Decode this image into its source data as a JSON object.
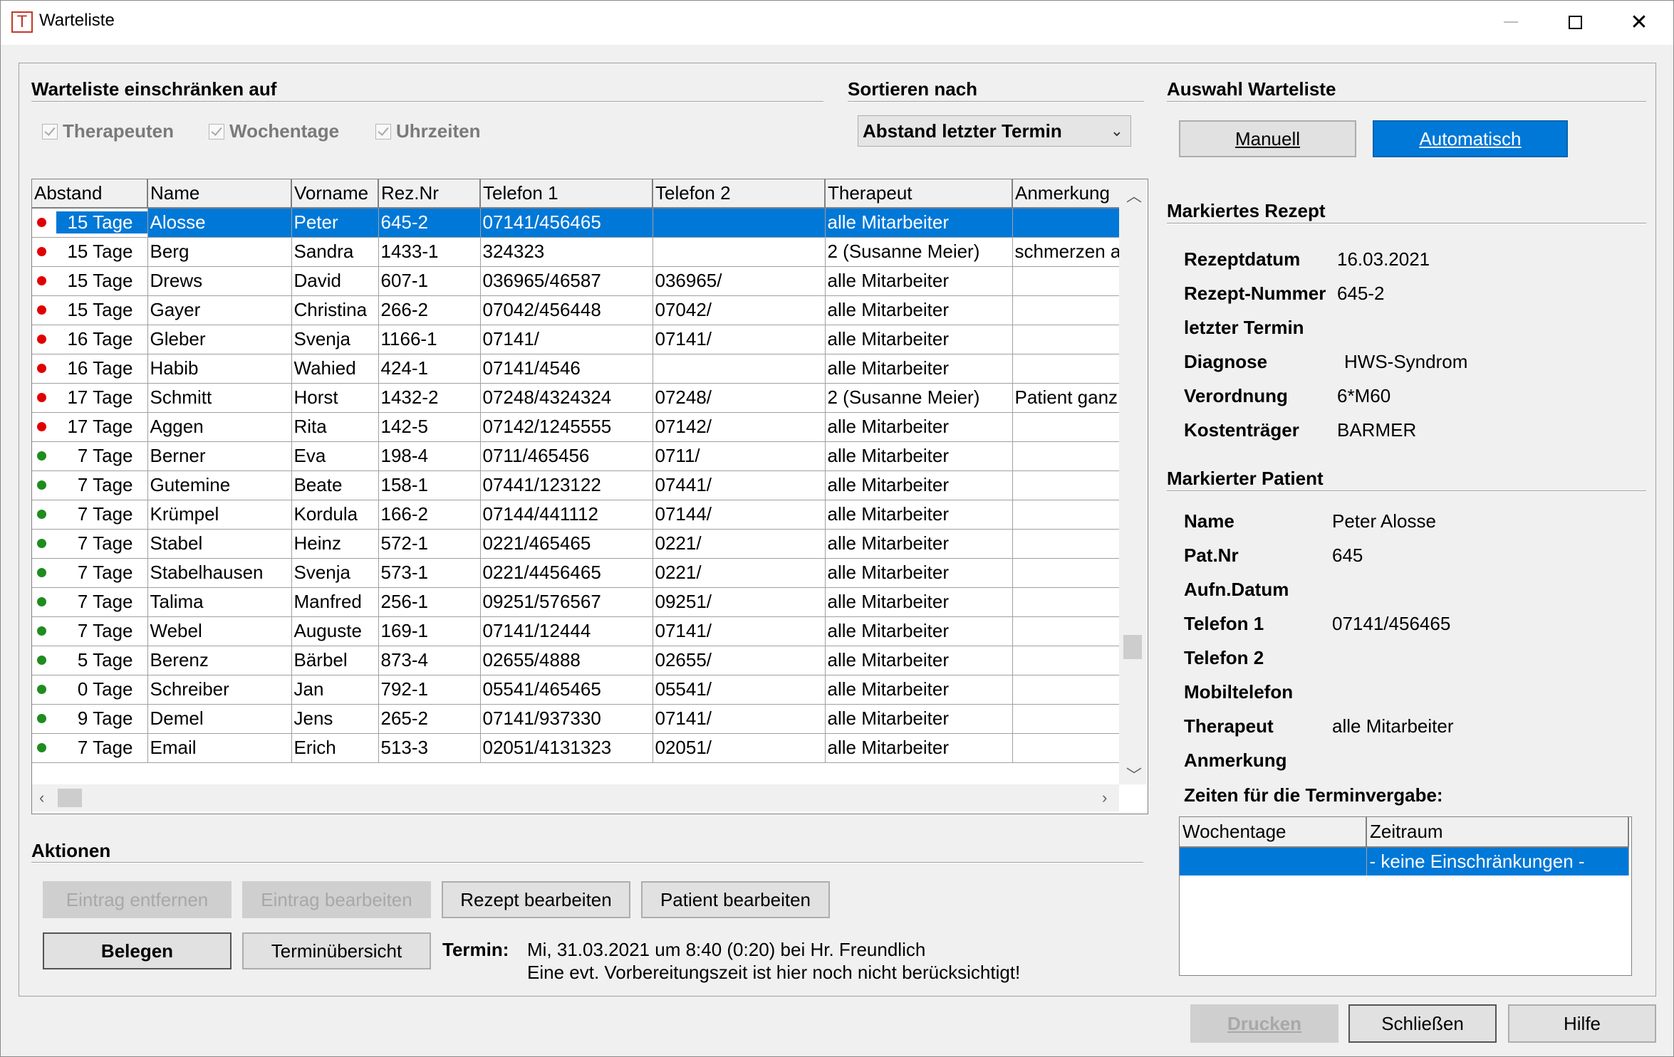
{
  "window": {
    "title": "Warteliste",
    "icon_letter": "T"
  },
  "filter": {
    "title": "Warteliste einschränken auf",
    "checkboxes": [
      "Therapeuten",
      "Wochentage",
      "Uhrzeiten"
    ]
  },
  "sort": {
    "title": "Sortieren nach",
    "selected": "Abstand letzter Termin"
  },
  "list_select": {
    "title": "Auswahl Warteliste",
    "manual": "Manuell",
    "auto": "Automatisch"
  },
  "table": {
    "columns": [
      "Abstand",
      "Name",
      "Vorname",
      "Rez.Nr",
      "Telefon 1",
      "Telefon 2",
      "Therapeut",
      "Anmerkung"
    ],
    "rows": [
      {
        "status": "red",
        "abstand": "15 Tage",
        "name": "Alosse",
        "vorname": "Peter",
        "rez": "645-2",
        "tel1": "07141/456465",
        "tel2": "",
        "therapeut": "alle Mitarbeiter",
        "anm": ""
      },
      {
        "status": "red",
        "abstand": "15 Tage",
        "name": "Berg",
        "vorname": "Sandra",
        "rez": "1433-1",
        "tel1": "324323",
        "tel2": "",
        "therapeut": "2 (Susanne Meier)",
        "anm": "schmerzen a"
      },
      {
        "status": "red",
        "abstand": "15 Tage",
        "name": "Drews",
        "vorname": "David",
        "rez": "607-1",
        "tel1": "036965/46587",
        "tel2": "036965/",
        "therapeut": "alle Mitarbeiter",
        "anm": ""
      },
      {
        "status": "red",
        "abstand": "15 Tage",
        "name": "Gayer",
        "vorname": "Christina",
        "rez": "266-2",
        "tel1": "07042/456448",
        "tel2": "07042/",
        "therapeut": "alle Mitarbeiter",
        "anm": ""
      },
      {
        "status": "red",
        "abstand": "16 Tage",
        "name": "Gleber",
        "vorname": "Svenja",
        "rez": "1166-1",
        "tel1": "07141/",
        "tel2": "07141/",
        "therapeut": "alle Mitarbeiter",
        "anm": ""
      },
      {
        "status": "red",
        "abstand": "16 Tage",
        "name": "Habib",
        "vorname": "Wahied",
        "rez": "424-1",
        "tel1": "07141/4546",
        "tel2": "",
        "therapeut": "alle Mitarbeiter",
        "anm": ""
      },
      {
        "status": "red",
        "abstand": "17 Tage",
        "name": "Schmitt",
        "vorname": "Horst",
        "rez": "1432-2",
        "tel1": "07248/4324324",
        "tel2": "07248/",
        "therapeut": "2 (Susanne Meier)",
        "anm": "Patient ganz"
      },
      {
        "status": "red",
        "abstand": "17 Tage",
        "name": "Aggen",
        "vorname": "Rita",
        "rez": "142-5",
        "tel1": "07142/1245555",
        "tel2": "07142/",
        "therapeut": "alle Mitarbeiter",
        "anm": ""
      },
      {
        "status": "green",
        "abstand": "7 Tage",
        "name": "Berner",
        "vorname": "Eva",
        "rez": "198-4",
        "tel1": "0711/465456",
        "tel2": "0711/",
        "therapeut": "alle Mitarbeiter",
        "anm": ""
      },
      {
        "status": "green",
        "abstand": "7 Tage",
        "name": "Gutemine",
        "vorname": "Beate",
        "rez": "158-1",
        "tel1": "07441/123122",
        "tel2": "07441/",
        "therapeut": "alle Mitarbeiter",
        "anm": ""
      },
      {
        "status": "green",
        "abstand": "7 Tage",
        "name": "Krümpel",
        "vorname": "Kordula",
        "rez": "166-2",
        "tel1": "07144/441112",
        "tel2": "07144/",
        "therapeut": "alle Mitarbeiter",
        "anm": ""
      },
      {
        "status": "green",
        "abstand": "7 Tage",
        "name": "Stabel",
        "vorname": "Heinz",
        "rez": "572-1",
        "tel1": "0221/465465",
        "tel2": "0221/",
        "therapeut": "alle Mitarbeiter",
        "anm": ""
      },
      {
        "status": "green",
        "abstand": "7 Tage",
        "name": "Stabelhausen",
        "vorname": "Svenja",
        "rez": "573-1",
        "tel1": "0221/4456465",
        "tel2": "0221/",
        "therapeut": "alle Mitarbeiter",
        "anm": ""
      },
      {
        "status": "green",
        "abstand": "7 Tage",
        "name": "Talima",
        "vorname": "Manfred",
        "rez": "256-1",
        "tel1": "09251/576567",
        "tel2": "09251/",
        "therapeut": "alle Mitarbeiter",
        "anm": ""
      },
      {
        "status": "green",
        "abstand": "7 Tage",
        "name": "Webel",
        "vorname": "Auguste",
        "rez": "169-1",
        "tel1": "07141/12444",
        "tel2": "07141/",
        "therapeut": "alle Mitarbeiter",
        "anm": ""
      },
      {
        "status": "green",
        "abstand": "5 Tage",
        "name": "Berenz",
        "vorname": "Bärbel",
        "rez": "873-4",
        "tel1": "02655/4888",
        "tel2": "02655/",
        "therapeut": "alle Mitarbeiter",
        "anm": ""
      },
      {
        "status": "green",
        "abstand": "0 Tage",
        "name": "Schreiber",
        "vorname": "Jan",
        "rez": "792-1",
        "tel1": "05541/465465",
        "tel2": "05541/",
        "therapeut": "alle Mitarbeiter",
        "anm": ""
      },
      {
        "status": "green",
        "abstand": "9 Tage",
        "name": "Demel",
        "vorname": "Jens",
        "rez": "265-2",
        "tel1": "07141/937330",
        "tel2": "07141/",
        "therapeut": "alle Mitarbeiter",
        "anm": ""
      },
      {
        "status": "green",
        "abstand": "7 Tage",
        "name": " Email",
        "vorname": "Erich",
        "rez": "513-3",
        "tel1": "02051/4131323",
        "tel2": "02051/",
        "therapeut": "alle Mitarbeiter",
        "anm": ""
      }
    ]
  },
  "rezept": {
    "title": "Markiertes Rezept",
    "fields": [
      {
        "label": "Rezeptdatum",
        "value": "16.03.2021"
      },
      {
        "label": "Rezept-Nummer",
        "value": "645-2"
      },
      {
        "label": "letzter Termin",
        "value": ""
      },
      {
        "label": "Diagnose",
        "value": "HWS-Syndrom"
      },
      {
        "label": "Verordnung",
        "value": "6*M60"
      },
      {
        "label": "Kostenträger",
        "value": "BARMER"
      }
    ]
  },
  "patient": {
    "title": "Markierter Patient",
    "fields": [
      {
        "label": "Name",
        "value": "Peter Alosse"
      },
      {
        "label": "Pat.Nr",
        "value": "645"
      },
      {
        "label": "Aufn.Datum",
        "value": ""
      },
      {
        "label": "Telefon 1",
        "value": "07141/456465"
      },
      {
        "label": "Telefon 2",
        "value": ""
      },
      {
        "label": "Mobiltelefon",
        "value": ""
      },
      {
        "label": "Therapeut",
        "value": "alle Mitarbeiter"
      },
      {
        "label": "Anmerkung",
        "value": ""
      }
    ],
    "times_title": "Zeiten für die Terminvergabe:",
    "times_columns": [
      "Wochentage",
      "Zeitraum"
    ],
    "times_rows": [
      {
        "tage": "",
        "zeitraum": "- keine Einschränkungen -"
      }
    ]
  },
  "actions": {
    "title": "Aktionen",
    "remove": "Eintrag entfernen",
    "edit": "Eintrag bearbeiten",
    "edit_rezept": "Rezept bearbeiten",
    "edit_patient": "Patient bearbeiten",
    "book": "Belegen",
    "overview": "Terminübersicht",
    "termin_label": "Termin:",
    "termin_line1": "Mi, 31.03.2021 um 8:40 (0:20) bei Hr. Freundlich",
    "termin_line2": "Eine evt. Vorbereitungszeit ist hier noch nicht berücksichtigt!"
  },
  "footer": {
    "print": "Drucken",
    "close": "Schließen",
    "help": "Hilfe"
  }
}
